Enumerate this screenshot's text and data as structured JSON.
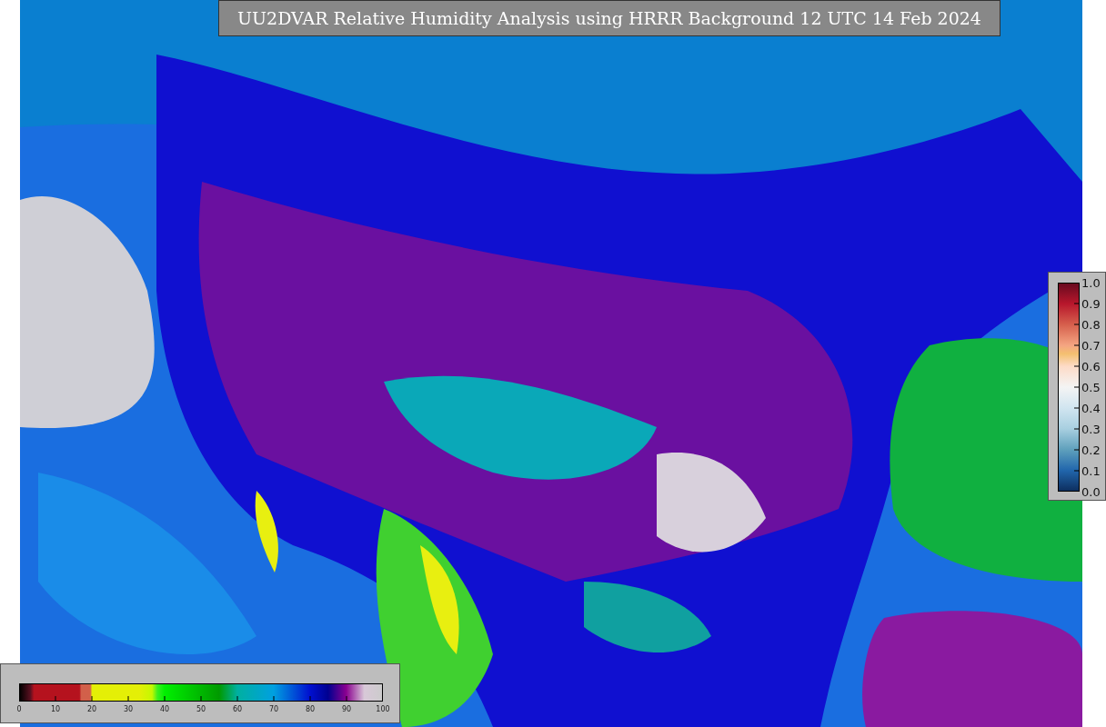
{
  "title": "UU2DVAR Relative Humidity Analysis using HRRR Background 12 UTC 14 Feb 2024",
  "humidity_colorbar": {
    "ticks": [
      "0",
      "10",
      "20",
      "30",
      "40",
      "50",
      "60",
      "70",
      "80",
      "90",
      "100"
    ]
  },
  "ratio_colorbar": {
    "ticks": [
      "1.0",
      "0.9",
      "0.8",
      "0.7",
      "0.6",
      "0.5",
      "0.4",
      "0.3",
      "0.2",
      "0.1",
      "0.0"
    ]
  }
}
